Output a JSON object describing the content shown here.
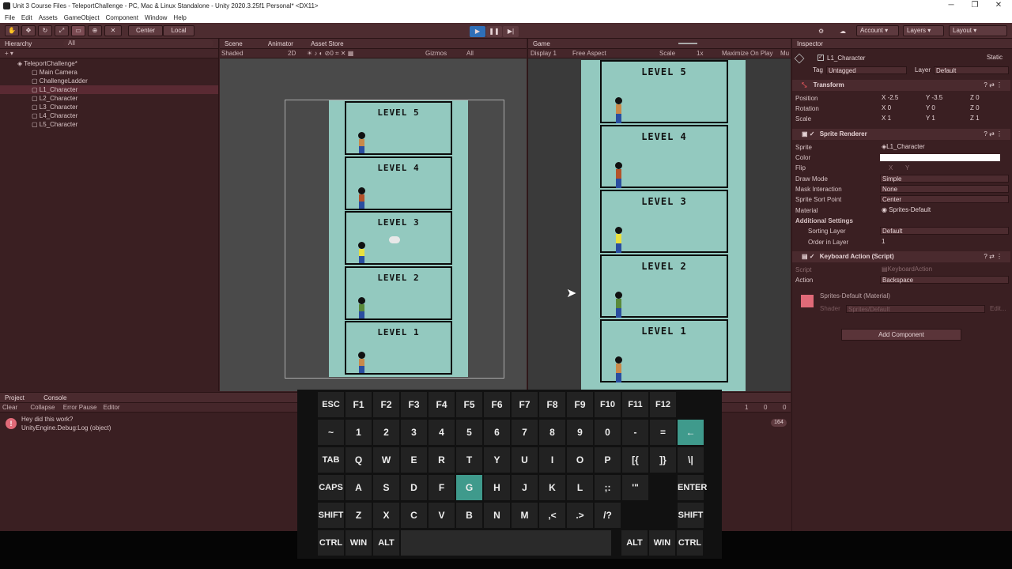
{
  "title": "Unit 3 Course Files - TeleportChallenge - PC, Mac & Linux Standalone - Unity 2020.3.25f1 Personal* <DX11>",
  "menu": [
    "File",
    "Edit",
    "Assets",
    "GameObject",
    "Component",
    "Window",
    "Help"
  ],
  "toolbar": {
    "center": "Center",
    "local": "Local",
    "account": "Account",
    "layers": "Layers",
    "layout": "Layout",
    "play": "▶",
    "pause": "❚❚",
    "step": "▶|"
  },
  "hierarchy": {
    "tab": "Hierarchy",
    "search": "All",
    "items": [
      {
        "label": "TeleportChallenge*",
        "indent": 0
      },
      {
        "label": "Main Camera",
        "indent": 1
      },
      {
        "label": "ChallengeLadder",
        "indent": 1
      },
      {
        "label": "L1_Character",
        "indent": 1
      },
      {
        "label": "L2_Character",
        "indent": 1
      },
      {
        "label": "L3_Character",
        "indent": 1
      },
      {
        "label": "L4_Character",
        "indent": 1
      },
      {
        "label": "L5_Character",
        "indent": 1
      }
    ]
  },
  "scene": {
    "tab": "Scene",
    "animator": "Animator",
    "asset_store": "Asset Store",
    "shaded": "Shaded",
    "mode2d": "2D",
    "gizmos": "Gizmos",
    "search": "All"
  },
  "game": {
    "tab": "Game",
    "display": "Display 1",
    "aspect": "Free Aspect",
    "scale_label": "Scale",
    "scale": "1x",
    "maximize": "Maximize On Play",
    "mute": "Mu"
  },
  "levels": [
    "LEVEL 5",
    "LEVEL 4",
    "LEVEL 3",
    "LEVEL 2",
    "LEVEL 1"
  ],
  "inspector": {
    "tab": "Inspector",
    "name": "L1_Character",
    "static": "Static",
    "tag_label": "Tag",
    "tag": "Untagged",
    "layer_label": "Layer",
    "layer": "Default",
    "transform": "Transform",
    "position_label": "Position",
    "pos_x": "-2.5",
    "pos_y": "-3.5",
    "pos_z": "0",
    "rotation_label": "Rotation",
    "rot_x": "0",
    "rot_y": "0",
    "rot_z": "0",
    "scale_label": "Scale",
    "sc_x": "1",
    "sc_y": "1",
    "sc_z": "1",
    "sprite_renderer": "Sprite Renderer",
    "sprite_label": "Sprite",
    "sprite": "L1_Character",
    "color_label": "Color",
    "flip_label": "Flip",
    "flip_x": "X",
    "flip_y": "Y",
    "draw_mode_label": "Draw Mode",
    "draw_mode": "Simple",
    "mask_label": "Mask Interaction",
    "mask": "None",
    "sort_point_label": "Sprite Sort Point",
    "sort_point": "Center",
    "material_label": "Material",
    "material": "Sprites-Default",
    "additional": "Additional Settings",
    "sorting_layer_label": "Sorting Layer",
    "sorting_layer": "Default",
    "order_label": "Order in Layer",
    "order": "1",
    "keyboard_action": "Keyboard Action (Script)",
    "script_label": "Script",
    "script": "KeyboardAction",
    "action_label": "Action",
    "action": "Backspace",
    "mat_name": "Sprites-Default (Material)",
    "shader_label": "Shader",
    "shader": "Sprites/Default",
    "edit": "Edit...",
    "add_component": "Add Component"
  },
  "console": {
    "project_tab": "Project",
    "console_tab": "Console",
    "clear": "Clear",
    "collapse": "Collapse",
    "error_pause": "Error Pause",
    "editor": "Editor",
    "msg1": "Hey did this work?",
    "msg2": "UnityEngine.Debug:Log (object)",
    "count_warn": "1",
    "count_info": "0",
    "count_err": "0",
    "badge": "164"
  },
  "keyboard": {
    "rows": [
      [
        "ESC",
        "F1",
        "F2",
        "F3",
        "F4",
        "F5",
        "F6",
        "F7",
        "F8",
        "F9",
        "F10",
        "F11",
        "F12"
      ],
      [
        "~",
        "1",
        "2",
        "3",
        "4",
        "5",
        "6",
        "7",
        "8",
        "9",
        "0",
        "-",
        "=",
        "←"
      ],
      [
        "TAB",
        "Q",
        "W",
        "E",
        "R",
        "T",
        "Y",
        "U",
        "I",
        "O",
        "P",
        "[{",
        "]}",
        "\\|"
      ],
      [
        "CAPS",
        "A",
        "S",
        "D",
        "F",
        "G",
        "H",
        "J",
        "K",
        "L",
        ";:",
        "'\"",
        " ",
        "ENTER"
      ],
      [
        "SHIFT",
        "Z",
        "X",
        "C",
        "V",
        "B",
        "N",
        "M",
        ",<",
        ".>",
        "/?",
        " ",
        " ",
        "SHIFT"
      ],
      [
        "CTRL",
        "WIN",
        "ALT",
        "",
        "ALT",
        "WIN",
        "CTRL"
      ]
    ],
    "highlighted": [
      "G",
      "←"
    ]
  },
  "colors": {
    "accent": "#3f9a8c",
    "level_bg": "#93c9bf",
    "panel": "#3a1f22"
  }
}
